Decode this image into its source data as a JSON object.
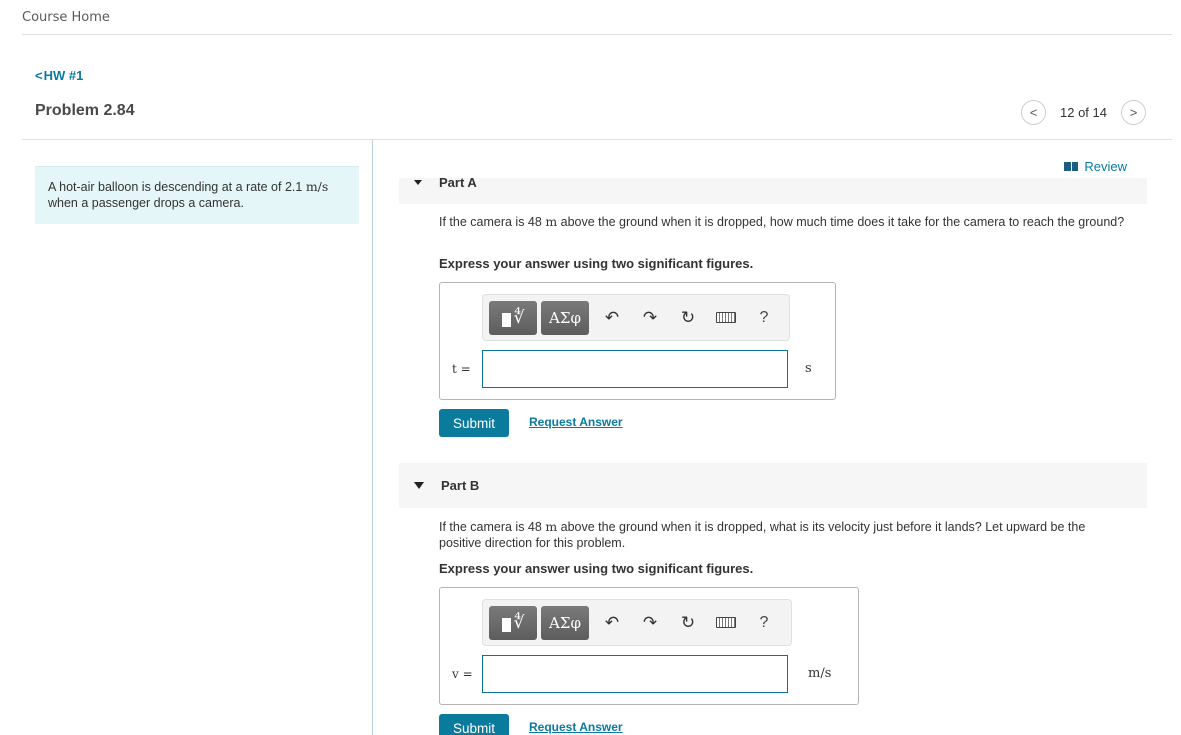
{
  "nav": {
    "course_home": "Course Home",
    "back_chevron": "<",
    "back_label": "HW #1",
    "problem_title": "Problem 2.84"
  },
  "pager": {
    "prev_icon": "<",
    "count": "12 of 14",
    "next_icon": ">"
  },
  "review": {
    "label": "Review"
  },
  "intro": {
    "text_before": "A hot-air balloon is descending at a rate of 2.1 ",
    "unit": "m/s",
    "text_after": "when a passenger drops a camera."
  },
  "parts": [
    {
      "label": "Part A",
      "question_before": "If the camera is 48 ",
      "question_unit": "m",
      "question_after": " above the ground when it is dropped, how much time does it take for the camera to reach the ground?",
      "instruction": "Express your answer using two significant figures.",
      "variable": "t =",
      "input_value": "",
      "unit": "s",
      "submit_label": "Submit",
      "request_label": "Request Answer"
    },
    {
      "label": "Part B",
      "question_before": "If the camera is 48 ",
      "question_unit": "m",
      "question_after": " above the ground when it is dropped, what is its velocity just before it lands? Let upward be the positive direction for this problem.",
      "instruction": "Express your answer using two significant figures.",
      "variable": "v =",
      "input_value": "",
      "unit": "m/s",
      "submit_label": "Submit",
      "request_label": "Request Answer"
    }
  ],
  "toolbar": {
    "templates_root": "∜",
    "greek": "ΑΣφ",
    "undo": "↶",
    "redo": "↷",
    "reset": "↻",
    "help": "?"
  },
  "colors": {
    "accent": "#0b7b9d",
    "link": "#0a7aa0",
    "intro_bg": "#e4f6f7",
    "part_header_bg": "#f6f6f6"
  }
}
